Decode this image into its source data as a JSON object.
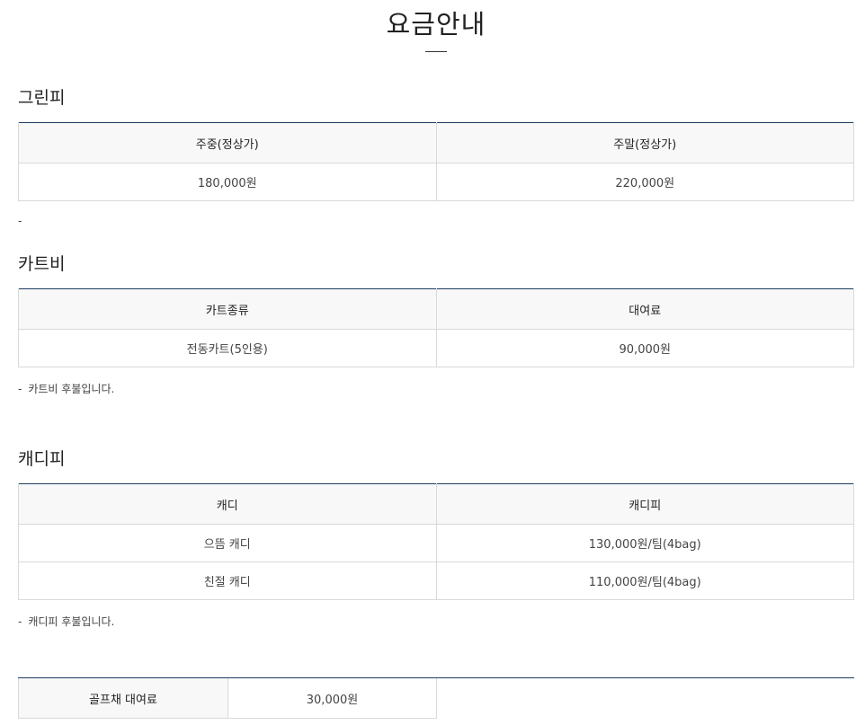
{
  "page_title": "요금안내",
  "greenfee": {
    "title": "그린피",
    "headers": [
      "주중(정상가)",
      "주말(정상가)"
    ],
    "rows": [
      [
        "180,000원",
        "220,000원"
      ]
    ],
    "note": "-"
  },
  "cart": {
    "title": "카트비",
    "headers": [
      "카트종류",
      "대여료"
    ],
    "rows": [
      [
        "전동카트(5인용)",
        "90,000원"
      ]
    ],
    "note_dash": "-",
    "note": "카트비 후불입니다."
  },
  "caddie": {
    "title": "캐디피",
    "headers": [
      "캐디",
      "캐디피"
    ],
    "rows": [
      [
        "으뜸 캐디",
        "130,000원/팀(4bag)"
      ],
      [
        "친절 캐디",
        "110,000원/팀(4bag)"
      ]
    ],
    "note_dash": "-",
    "note": "캐디피 후불입니다."
  },
  "rental": {
    "label": "골프채 대여료",
    "value": "30,000원"
  }
}
